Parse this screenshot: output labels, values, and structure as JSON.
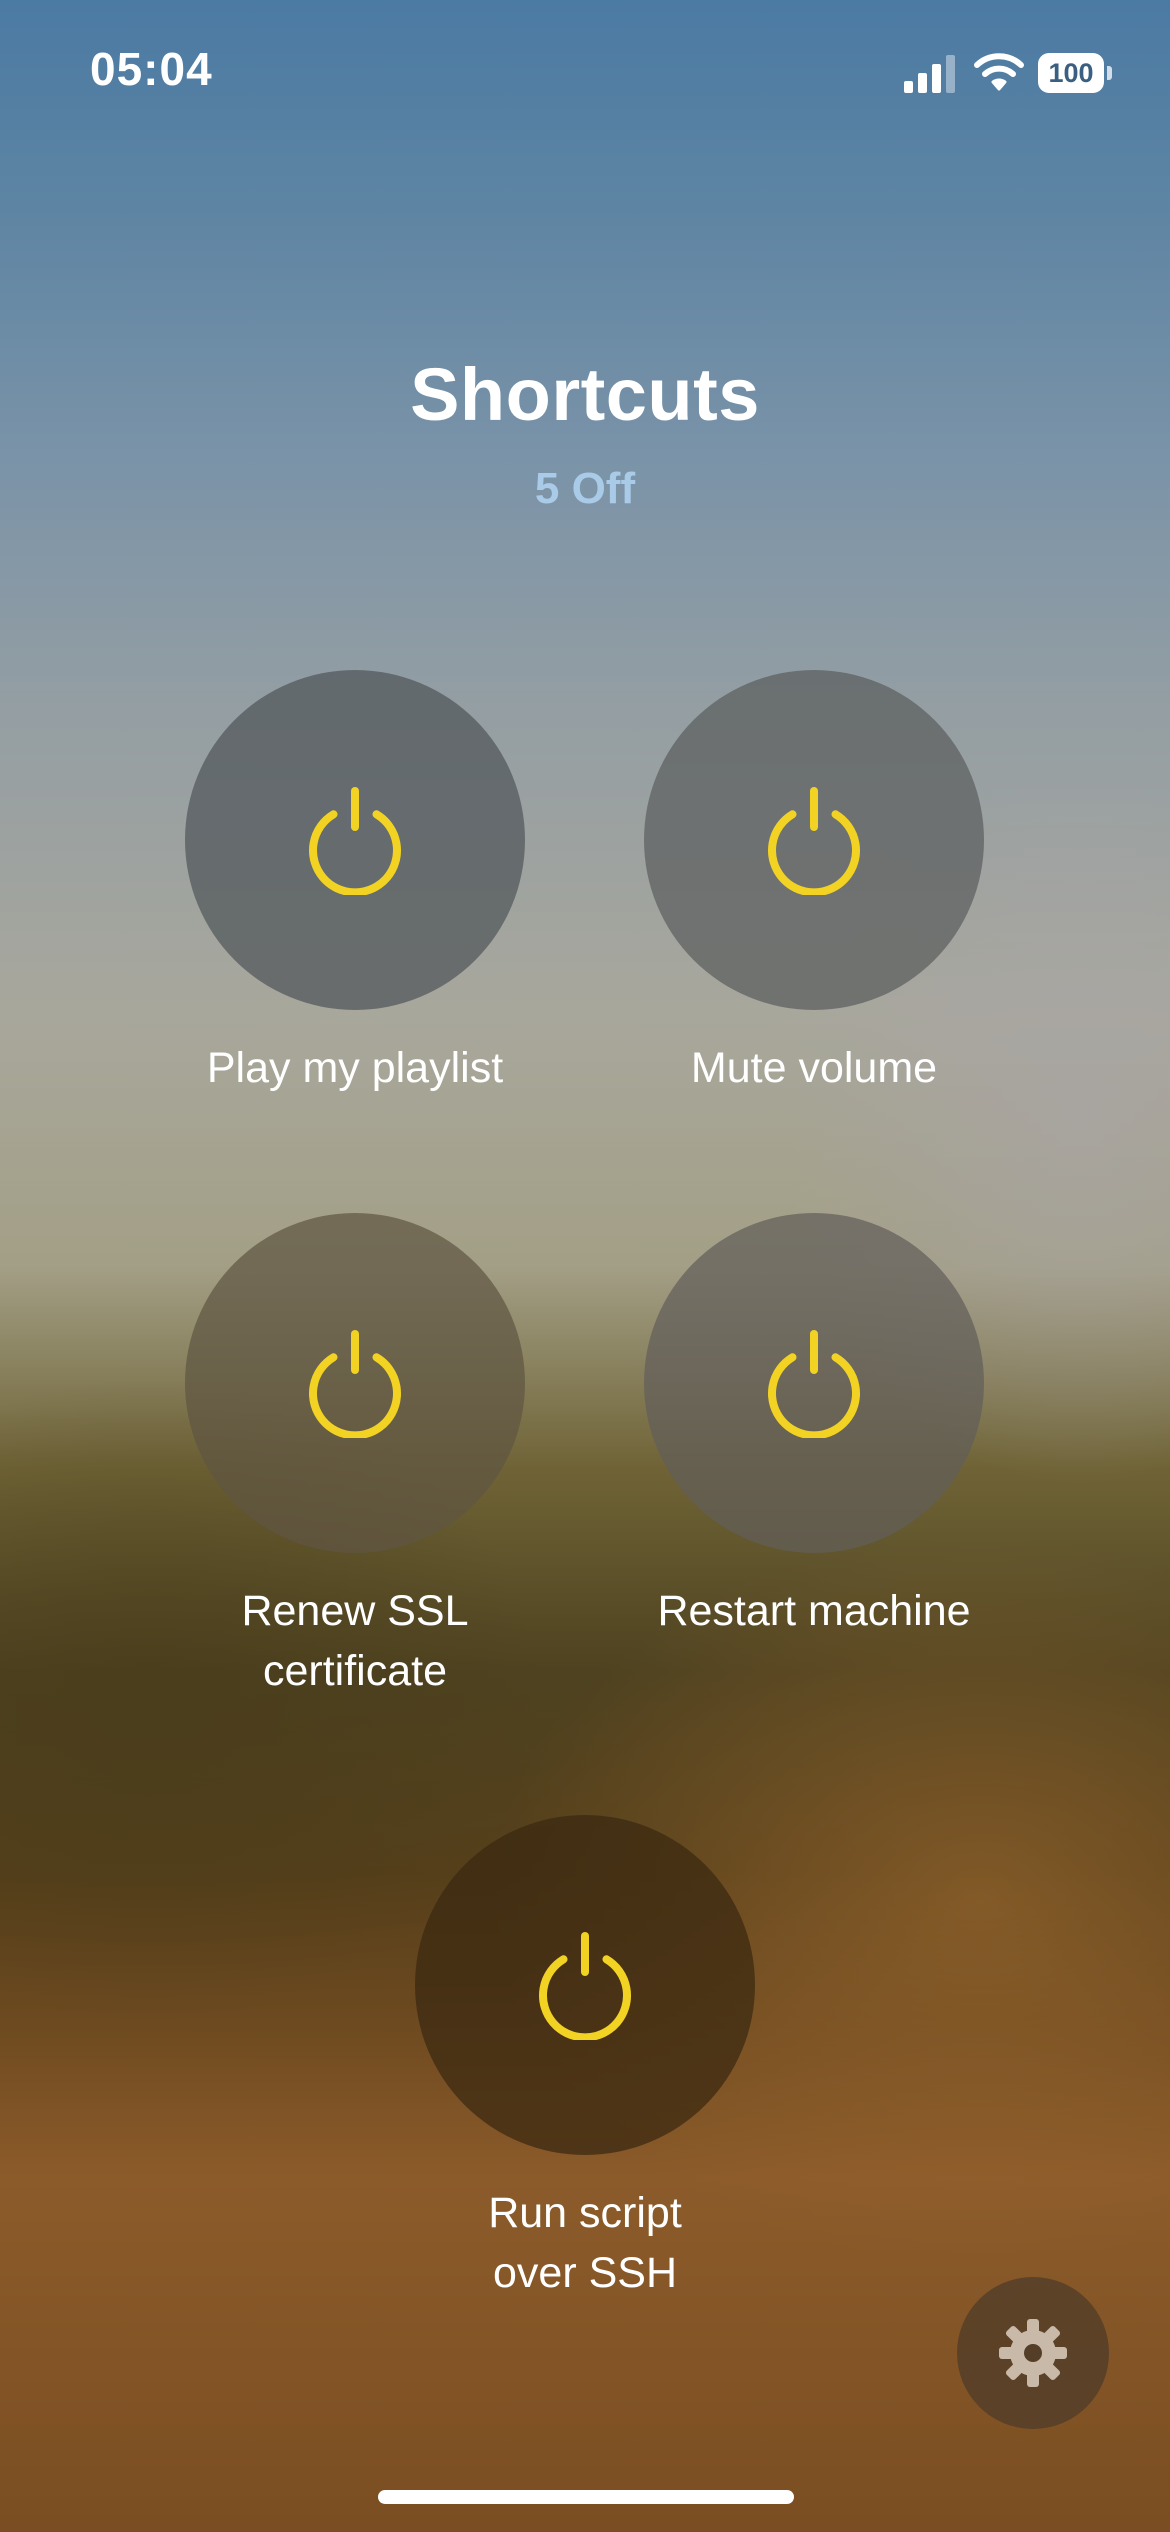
{
  "status_bar": {
    "time": "05:04",
    "battery_level": "100",
    "signal_icon": "cellular-signal-icon",
    "wifi_icon": "wifi-icon"
  },
  "header": {
    "title": "Shortcuts",
    "subtitle": "5 Off"
  },
  "shortcuts": [
    {
      "label": "Play my playlist",
      "icon": "power-icon",
      "state": "off"
    },
    {
      "label": "Mute volume",
      "icon": "power-icon",
      "state": "off"
    },
    {
      "label": "Renew SSL\ncertificate",
      "icon": "power-icon",
      "state": "off"
    },
    {
      "label": "Restart machine",
      "icon": "power-icon",
      "state": "off"
    },
    {
      "label": "Run script\nover SSH",
      "icon": "power-icon",
      "state": "off"
    }
  ],
  "settings": {
    "icon": "gear-icon"
  },
  "colors": {
    "power_icon": "#f2d323",
    "subtitle": "#a9cbe8",
    "text": "#ffffff"
  }
}
